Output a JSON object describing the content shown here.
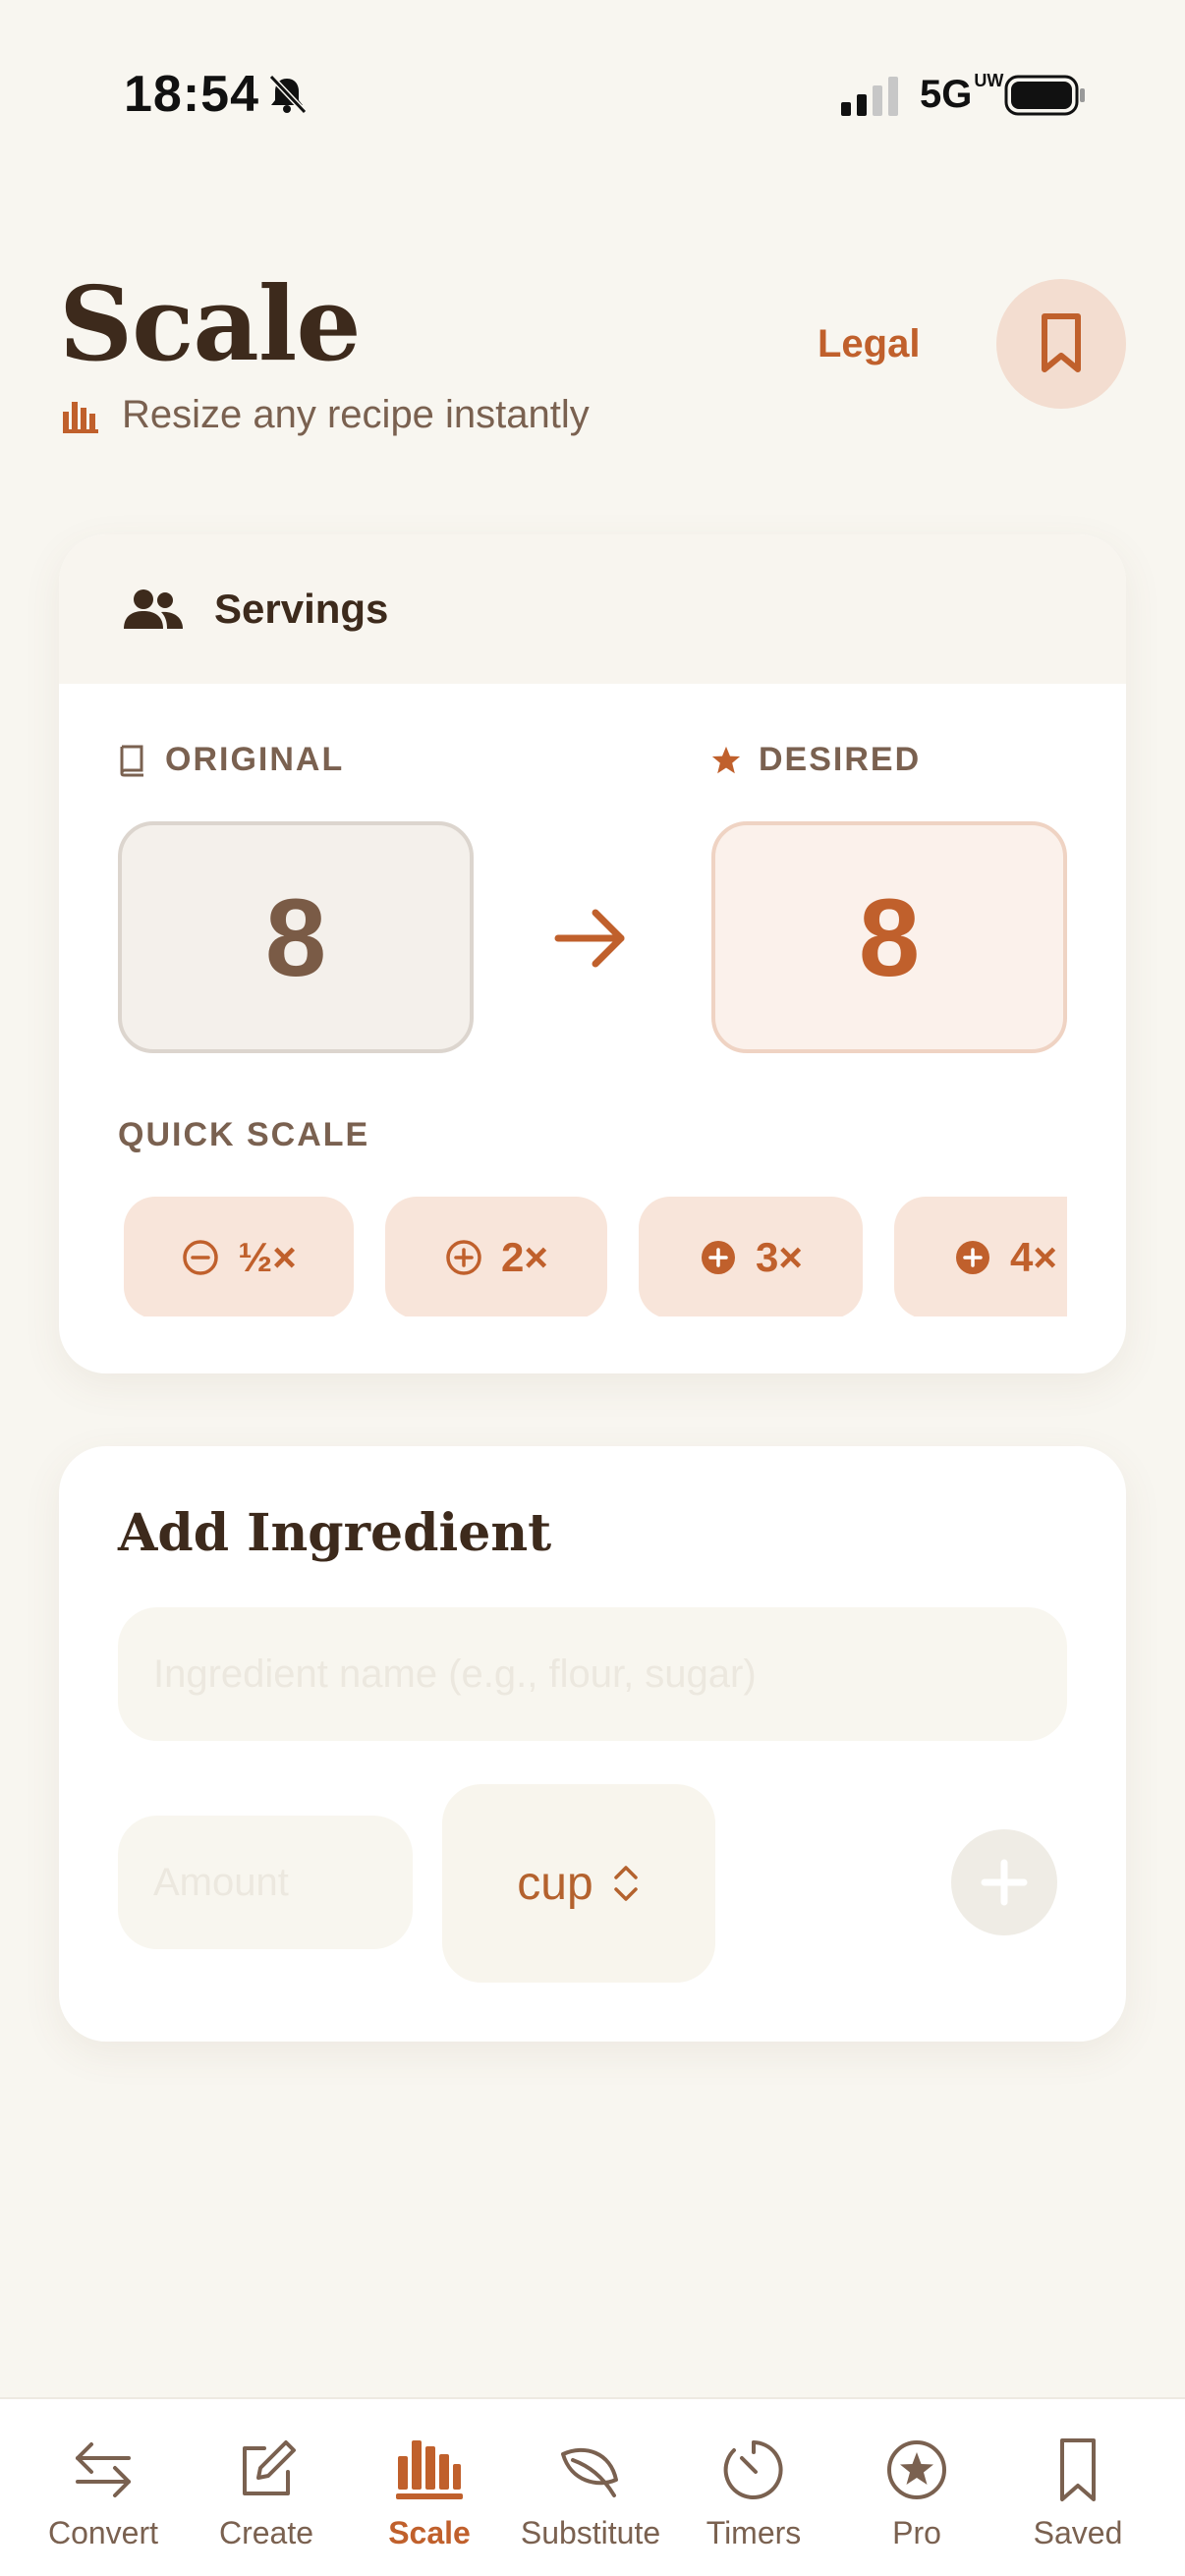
{
  "status_bar": {
    "time": "18:54",
    "network": "5G",
    "network_sub": "UW"
  },
  "header": {
    "title": "Scale",
    "subtitle": "Resize any recipe instantly",
    "legal_label": "Legal"
  },
  "servings": {
    "title": "Servings",
    "original_label": "ORIGINAL",
    "original_value": "8",
    "desired_label": "DESIRED",
    "desired_value": "8",
    "quick_scale_label": "QUICK SCALE",
    "quick_options": [
      "½×",
      "2×",
      "3×",
      "4×"
    ]
  },
  "add_ingredient": {
    "title": "Add Ingredient",
    "name_placeholder": "Ingredient name (e.g., flour, sugar)",
    "amount_placeholder": "Amount",
    "unit": "cup"
  },
  "tabs": [
    {
      "label": "Convert",
      "icon": "arrows-swap-icon"
    },
    {
      "label": "Create",
      "icon": "edit-icon"
    },
    {
      "label": "Scale",
      "icon": "chart-bars-icon",
      "active": true
    },
    {
      "label": "Substitute",
      "icon": "leaf-icon"
    },
    {
      "label": "Timers",
      "icon": "timer-icon"
    },
    {
      "label": "Pro",
      "icon": "star-circle-icon"
    },
    {
      "label": "Saved",
      "icon": "bookmark-icon"
    }
  ],
  "colors": {
    "background": "#f8f6f0",
    "accent": "#c0602c",
    "text_dark": "#3d2a1c",
    "text_muted": "#7a6150"
  }
}
